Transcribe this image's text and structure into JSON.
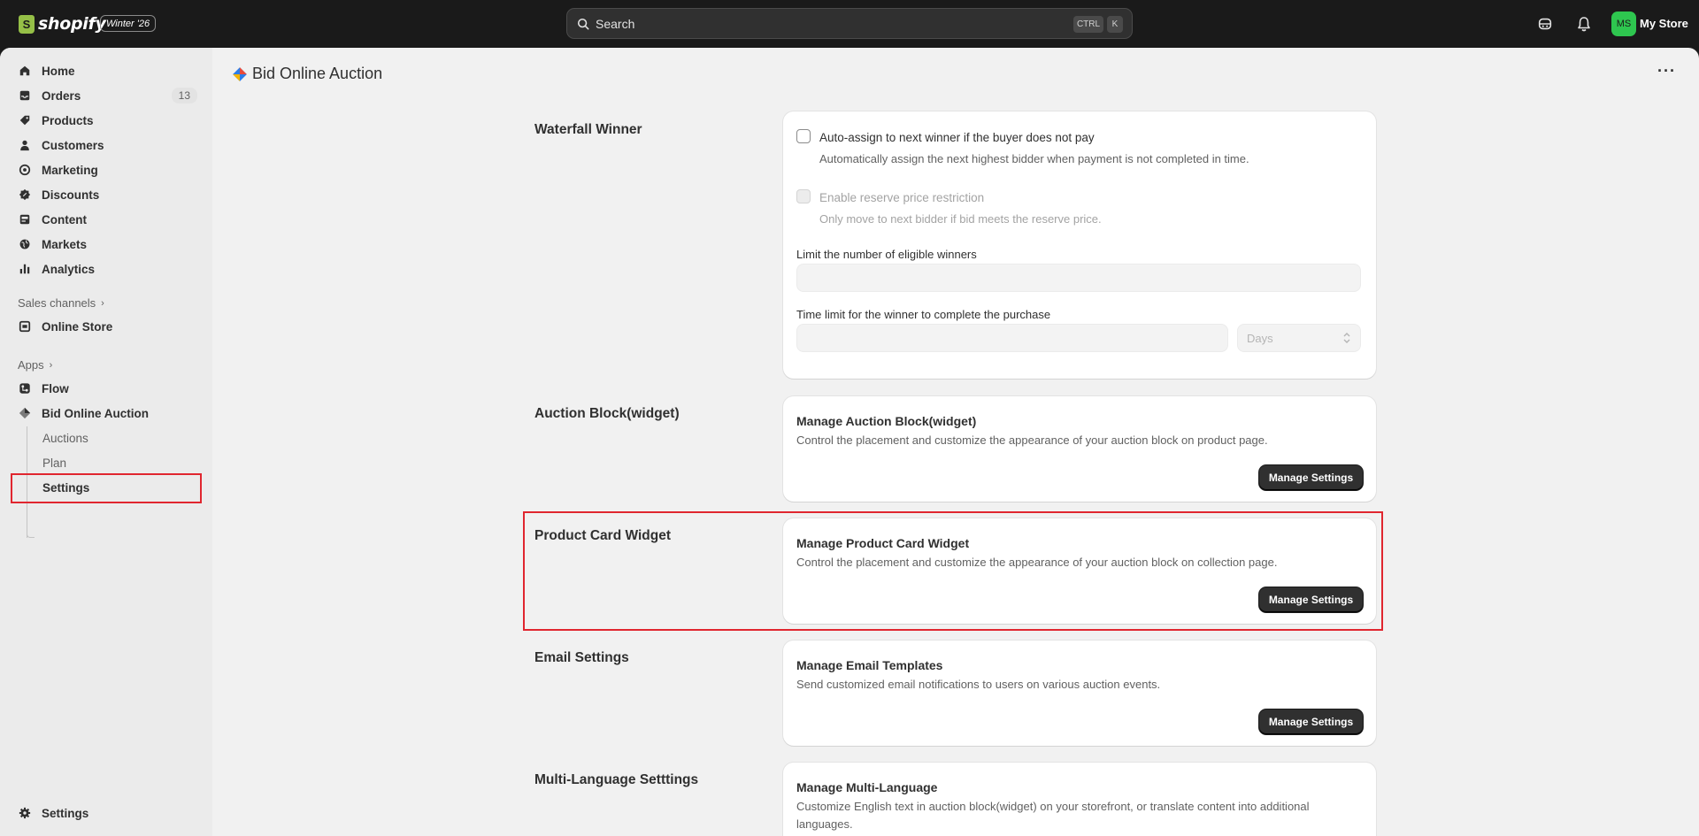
{
  "topbar": {
    "brand": "shopify",
    "edition": "Winter '26",
    "search_placeholder": "Search",
    "shortcut_ctrl": "CTRL",
    "shortcut_key": "K",
    "avatar_initials": "MS",
    "store_name": "My Store"
  },
  "sidebar": {
    "items": [
      {
        "label": "Home",
        "icon": "home-icon"
      },
      {
        "label": "Orders",
        "icon": "inbox-icon",
        "badge": "13"
      },
      {
        "label": "Products",
        "icon": "tag-icon"
      },
      {
        "label": "Customers",
        "icon": "person-icon"
      },
      {
        "label": "Marketing",
        "icon": "target-icon"
      },
      {
        "label": "Discounts",
        "icon": "discount-icon"
      },
      {
        "label": "Content",
        "icon": "content-icon"
      },
      {
        "label": "Markets",
        "icon": "globe-icon"
      },
      {
        "label": "Analytics",
        "icon": "bar-chart-icon"
      }
    ],
    "sales_channels_label": "Sales channels",
    "online_store": "Online Store",
    "apps_label": "Apps",
    "flow": "Flow",
    "bid_app": "Bid Online Auction",
    "sub_items": [
      "Auctions",
      "Plan",
      "Settings"
    ],
    "settings": "Settings"
  },
  "page": {
    "title": "Bid Online Auction",
    "more": "···"
  },
  "waterfall": {
    "title": "Waterfall Winner",
    "auto_assign_label": "Auto-assign to next winner if the buyer does not pay",
    "auto_assign_help": "Automatically assign the next highest bidder when payment is not completed in time.",
    "reserve_label": "Enable reserve price restriction",
    "reserve_help": "Only move to next bidder if bid meets the reserve price.",
    "limit_label": "Limit the number of eligible winners",
    "time_limit_label": "Time limit for the winner to complete the purchase",
    "time_unit": "Days"
  },
  "sections": [
    {
      "row_title": "Auction Block(widget)",
      "card_title": "Manage Auction Block(widget)",
      "desc": "Control the placement and customize the appearance of your auction block on product page.",
      "button": "Manage Settings"
    },
    {
      "row_title": "Product Card Widget",
      "card_title": "Manage Product Card Widget",
      "desc": "Control the placement and customize the appearance of your auction block on collection page.",
      "button": "Manage Settings"
    },
    {
      "row_title": "Email Settings",
      "card_title": "Manage Email Templates",
      "desc": "Send customized email notifications to users on various auction events.",
      "button": "Manage Settings"
    },
    {
      "row_title": "Multi-Language Setttings",
      "card_title": "Manage Multi-Language",
      "desc": "Customize English text in auction block(widget) on your storefront, or translate content into additional",
      "desc2": "languages."
    }
  ]
}
